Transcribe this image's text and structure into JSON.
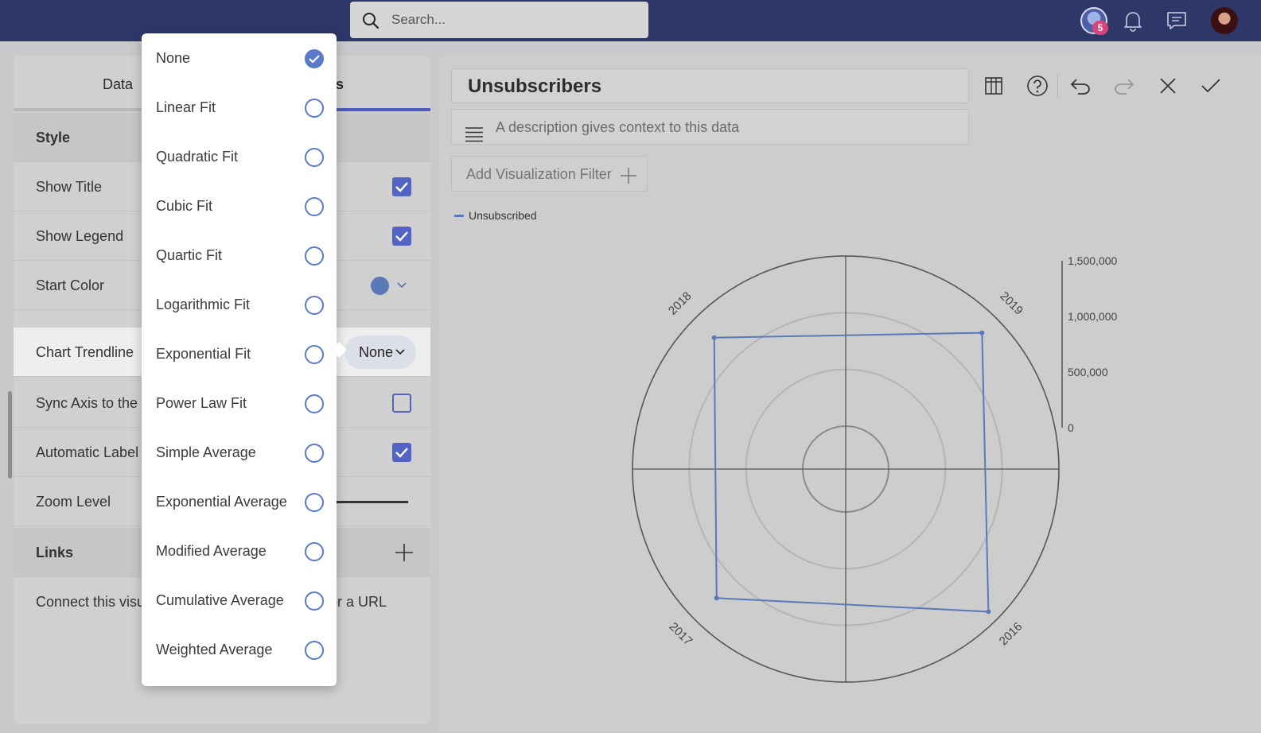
{
  "topbar": {
    "search_placeholder": "Search...",
    "notification_badge": "5"
  },
  "left_panel": {
    "tabs": [
      {
        "label": "Data",
        "active": false
      },
      {
        "label": "Settings",
        "active": true
      }
    ],
    "visible_tab_fragment": "gs",
    "rows": [
      {
        "label": "Style",
        "type": "section"
      },
      {
        "label": "Show Title",
        "type": "checkbox",
        "checked": true
      },
      {
        "label": "Show Legend",
        "type": "checkbox",
        "checked": true
      },
      {
        "label": "Start Color",
        "type": "color",
        "value": "#5b79b8"
      },
      {
        "label": "Chart Trendline",
        "type": "select",
        "value": "None"
      },
      {
        "label": "Sync Axis to the V",
        "type": "checkbox",
        "checked": false
      },
      {
        "label": "Automatic Label",
        "type": "checkbox",
        "checked": true
      },
      {
        "label": "Zoom Level",
        "type": "slider"
      },
      {
        "label": "Links",
        "type": "section"
      },
      {
        "label": "Connect this visu",
        "suffix": "or a URL",
        "type": "text"
      }
    ]
  },
  "trendline_dropdown": {
    "options": [
      {
        "label": "None",
        "selected": true
      },
      {
        "label": "Linear Fit",
        "selected": false
      },
      {
        "label": "Quadratic Fit",
        "selected": false
      },
      {
        "label": "Cubic Fit",
        "selected": false
      },
      {
        "label": "Quartic Fit",
        "selected": false
      },
      {
        "label": "Logarithmic Fit",
        "selected": false
      },
      {
        "label": "Exponential Fit",
        "selected": false
      },
      {
        "label": "Power Law Fit",
        "selected": false
      },
      {
        "label": "Simple Average",
        "selected": false
      },
      {
        "label": "Exponential Average",
        "selected": false
      },
      {
        "label": "Modified Average",
        "selected": false
      },
      {
        "label": "Cumulative Average",
        "selected": false
      },
      {
        "label": "Weighted Average",
        "selected": false
      }
    ]
  },
  "editor": {
    "title": "Unsubscribers",
    "description_placeholder": "A description gives context to this data",
    "filter_button": "Add Visualization Filter",
    "toolbar_icons": [
      "table-icon",
      "help-icon",
      "undo-icon",
      "redo-icon",
      "close-icon",
      "check-icon"
    ]
  },
  "colors": {
    "topbar": "#2d3768",
    "accent": "#4c5bbd",
    "series": "#5b79b8"
  },
  "chart_data": {
    "type": "radar",
    "legend": [
      "Unsubscribed"
    ],
    "legend_position": "top-left",
    "categories": [
      "2019",
      "2016",
      "2017",
      "2018"
    ],
    "series": [
      {
        "name": "Unsubscribed",
        "values": [
          1320000,
          1400000,
          1230000,
          1260000
        ]
      }
    ],
    "radial_axis": {
      "min": 0,
      "max": 1500000,
      "ticks": [
        0,
        500000,
        1000000,
        1500000
      ],
      "tick_labels": [
        "0",
        "500,000",
        "1,000,000",
        "1,500,000"
      ]
    },
    "grid": true
  }
}
